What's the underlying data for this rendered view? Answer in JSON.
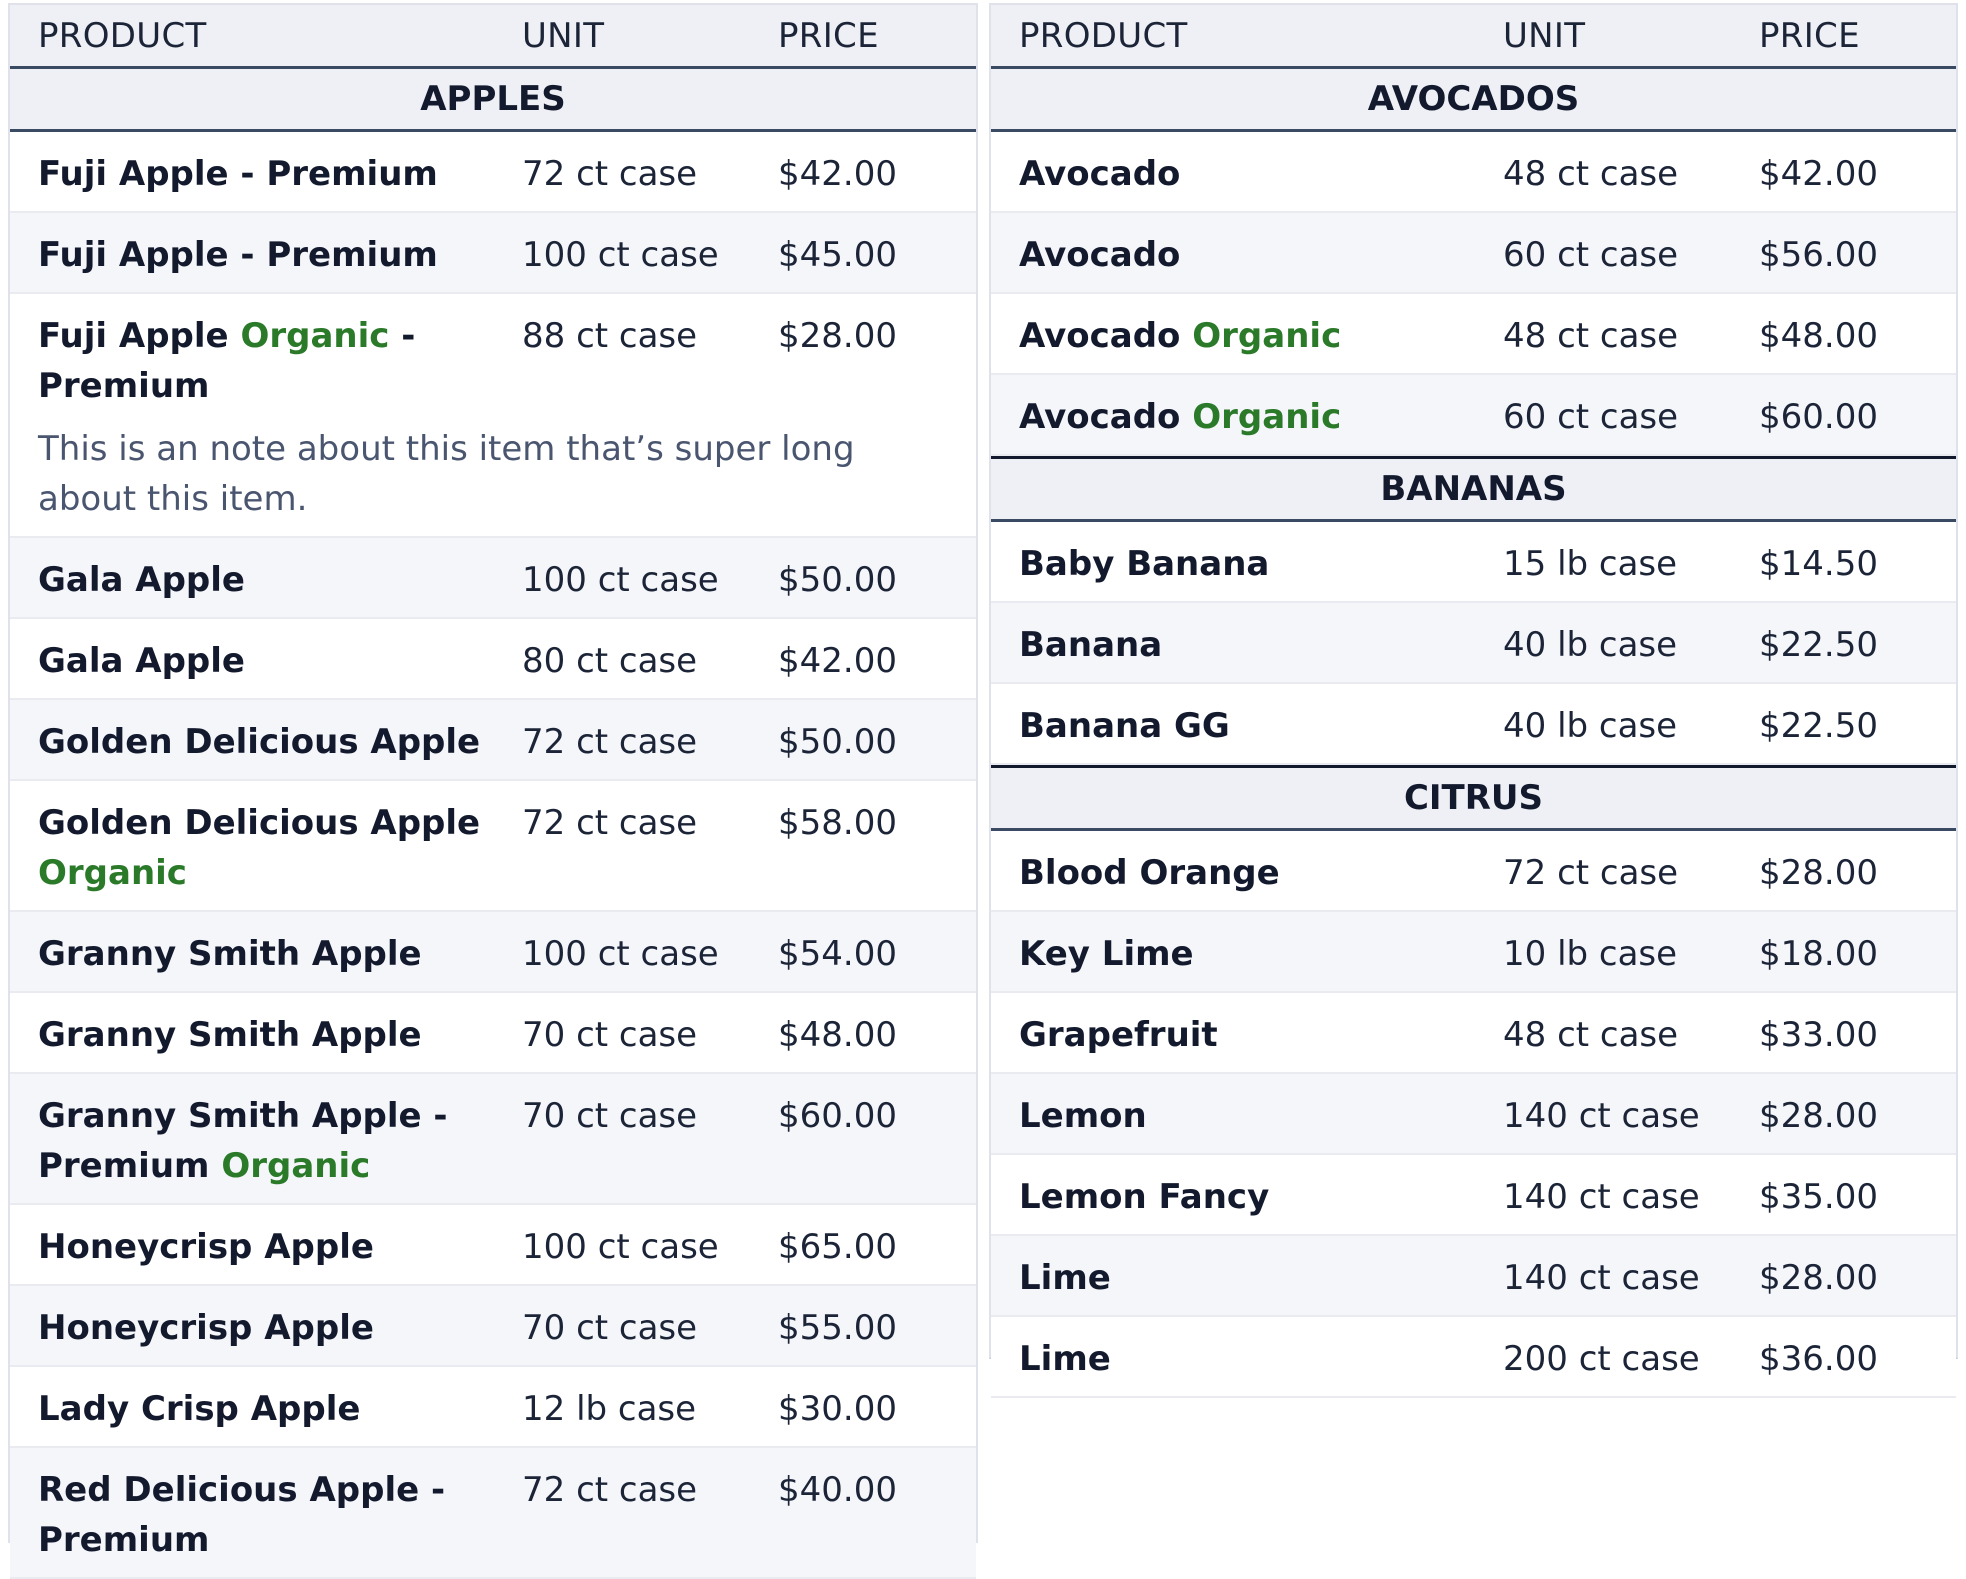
{
  "columns": {
    "product": "PRODUCT",
    "unit": "UNIT",
    "price": "PRICE"
  },
  "organic_label": "Organic",
  "colors": {
    "organic": "#2a7a2a",
    "header_bg": "#eef0f5",
    "rule": "#3b4a63",
    "text": "#141a2e"
  },
  "left": {
    "categories": [
      {
        "name": "APPLES",
        "items": [
          {
            "name": "Fuji Apple - Premium",
            "unit": "72 ct case",
            "price": "$42.00"
          },
          {
            "name": "Fuji Apple - Premium",
            "unit": "100 ct case",
            "price": "$45.00"
          },
          {
            "name_before": "Fuji Apple ",
            "organic": "Organic",
            "name_after": " - Premium",
            "unit": "88 ct case",
            "price": "$28.00",
            "note": "This is an note about this item that’s super long about this item."
          },
          {
            "name": "Gala Apple",
            "unit": "100 ct case",
            "price": "$50.00"
          },
          {
            "name": "Gala Apple",
            "unit": "80 ct case",
            "price": "$42.00"
          },
          {
            "name": "Golden Delicious Apple",
            "unit": "72 ct case",
            "price": "$50.00"
          },
          {
            "name_before": "Golden Delicious Apple ",
            "organic": "Organic",
            "name_after": "",
            "unit": "72 ct case",
            "price": "$58.00"
          },
          {
            "name": "Granny Smith Apple",
            "unit": "100 ct case",
            "price": "$54.00"
          },
          {
            "name": "Granny Smith Apple",
            "unit": "70 ct case",
            "price": "$48.00"
          },
          {
            "name_before": "Granny Smith Apple - Premium ",
            "organic": "Organic",
            "name_after": "",
            "unit": "70 ct case",
            "price": "$60.00"
          },
          {
            "name": "Honeycrisp Apple",
            "unit": "100 ct case",
            "price": "$65.00"
          },
          {
            "name": "Honeycrisp Apple",
            "unit": "70 ct case",
            "price": "$55.00"
          },
          {
            "name": "Lady Crisp Apple",
            "unit": "12 lb case",
            "price": "$30.00"
          },
          {
            "name": "Red Delicious Apple - Premium",
            "unit": "72 ct case",
            "price": "$40.00"
          }
        ]
      }
    ]
  },
  "right": {
    "categories": [
      {
        "name": "AVOCADOS",
        "items": [
          {
            "name": "Avocado",
            "unit": "48 ct case",
            "price": "$42.00"
          },
          {
            "name": "Avocado",
            "unit": "60 ct case",
            "price": "$56.00"
          },
          {
            "name_before": "Avocado ",
            "organic": "Organic",
            "name_after": "",
            "unit": "48 ct case",
            "price": "$48.00"
          },
          {
            "name_before": "Avocado ",
            "organic": "Organic",
            "name_after": "",
            "unit": "60 ct case",
            "price": "$60.00"
          }
        ]
      },
      {
        "name": "BANANAS",
        "items": [
          {
            "name": "Baby Banana",
            "unit": "15 lb case",
            "price": "$14.50"
          },
          {
            "name": "Banana",
            "unit": "40 lb case",
            "price": "$22.50"
          },
          {
            "name": "Banana GG",
            "unit": "40 lb case",
            "price": "$22.50"
          }
        ]
      },
      {
        "name": "CITRUS",
        "items": [
          {
            "name": "Blood Orange",
            "unit": "72 ct case",
            "price": "$28.00"
          },
          {
            "name": "Key Lime",
            "unit": "10 lb case",
            "price": "$18.00"
          },
          {
            "name": "Grapefruit",
            "unit": "48 ct case",
            "price": "$33.00"
          },
          {
            "name": "Lemon",
            "unit": "140 ct case",
            "price": "$28.00"
          },
          {
            "name": "Lemon Fancy",
            "unit": "140 ct case",
            "price": "$35.00"
          },
          {
            "name": "Lime",
            "unit": "140 ct case",
            "price": "$28.00"
          },
          {
            "name": "Lime",
            "unit": "200 ct case",
            "price": "$36.00"
          }
        ]
      }
    ]
  }
}
